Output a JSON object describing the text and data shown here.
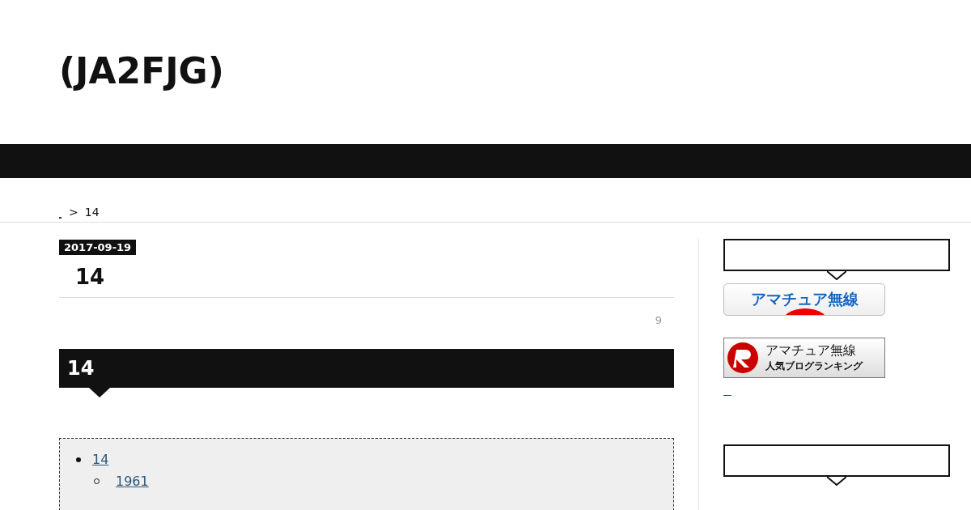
{
  "site_title": "(JA2FJG)",
  "breadcrumb": {
    "separator": ">",
    "current": "14"
  },
  "post": {
    "date": "2017-09-19",
    "title": "14",
    "count": "9",
    "section_heading": "14",
    "toc": [
      {
        "label": "14",
        "children": [
          {
            "label": "1961"
          }
        ]
      }
    ]
  },
  "sidebar": {
    "banners": [
      {
        "kind": "blue",
        "title": "アマチュア無線"
      },
      {
        "kind": "ranking",
        "title": "アマチュア無線",
        "subtitle": "人気ブログランキング"
      }
    ]
  }
}
